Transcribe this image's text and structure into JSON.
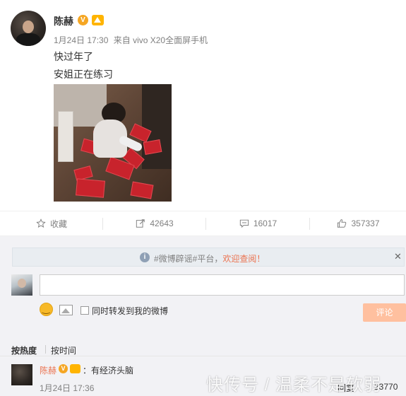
{
  "post": {
    "author": "陈赫",
    "date": "1月24日 17:30",
    "source": "来自 vivo X20全面屏手机",
    "text_lines": [
      "快过年了",
      "安姐正在练习"
    ],
    "verified_mark": "V"
  },
  "actions": {
    "favorite": "收藏",
    "reposts": "42643",
    "comments": "16017",
    "likes": "357337"
  },
  "notice": {
    "info_mark": "i",
    "text": "#微博辟谣#平台，",
    "link": "欢迎查阅！",
    "close": "✕"
  },
  "composer": {
    "input_value": "",
    "repost_label": "同时转发到我的微博",
    "submit_label": "评论"
  },
  "sort": {
    "hot": "按热度",
    "time": "按时间"
  },
  "comment": {
    "author": "陈赫",
    "verified_mark": "V",
    "text": "：有经济头脑",
    "date": "1月24日 17:36",
    "reply": "回复",
    "likes": "23770"
  },
  "watermark": "快传号 / 温柔不是软弱",
  "colors": {
    "link_orange": "#eb7350",
    "verified_badge": "#f5a623",
    "submit_disabled": "#ffc09f",
    "comment_bg": "#f2f2f5"
  }
}
